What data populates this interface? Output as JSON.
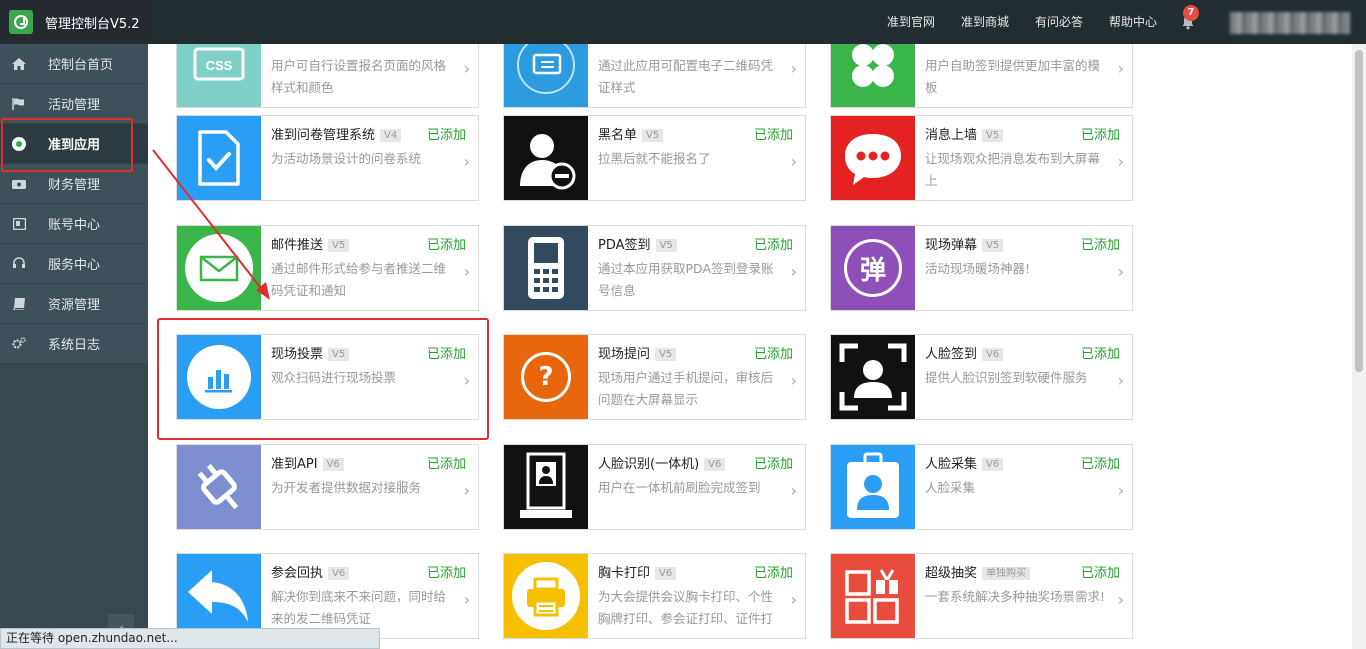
{
  "header": {
    "brand_title": "管理控制台V5.2",
    "nav": [
      "准到官网",
      "准到商城",
      "有问必答",
      "帮助中心"
    ],
    "notification_count": "7"
  },
  "sidebar": {
    "items": [
      {
        "label": "控制台首页",
        "icon": "home-icon"
      },
      {
        "label": "活动管理",
        "icon": "flag-icon"
      },
      {
        "label": "准到应用",
        "icon": "app-icon"
      },
      {
        "label": "财务管理",
        "icon": "finance-icon"
      },
      {
        "label": "账号中心",
        "icon": "account-icon"
      },
      {
        "label": "服务中心",
        "icon": "headset-icon"
      },
      {
        "label": "资源管理",
        "icon": "book-icon"
      },
      {
        "label": "系统日志",
        "icon": "cogs-icon"
      }
    ],
    "active_index": 2,
    "collapse_glyph": "‹"
  },
  "apps": [
    {
      "title": "",
      "ver": "",
      "added": "",
      "desc": "用户可自行设置报名页面的风格样式和颜色",
      "icon": "css-icon",
      "color": "#7fd1c7"
    },
    {
      "title": "",
      "ver": "",
      "added": "",
      "desc": "通过此应用可配置电子二维码凭证样式",
      "icon": "ticket-icon",
      "color": "#2d9be0"
    },
    {
      "title": "",
      "ver": "",
      "added": "",
      "desc": "用户自助签到提供更加丰富的模板",
      "icon": "clover-icon",
      "color": "#3ab54a"
    },
    {
      "title": "准到问卷管理系统",
      "ver": "V4",
      "added": "已添加",
      "desc": "为活动场景设计的问卷系统",
      "icon": "survey-icon",
      "color": "#2a9df4"
    },
    {
      "title": "黑名单",
      "ver": "V5",
      "added": "已添加",
      "desc": "拉黑后就不能报名了",
      "icon": "blacklist-icon",
      "color": "#111111"
    },
    {
      "title": "消息上墙",
      "ver": "V5",
      "added": "已添加",
      "desc": "让现场观众把消息发布到大屏幕上",
      "icon": "chat-icon",
      "color": "#e52222"
    },
    {
      "title": "邮件推送",
      "ver": "V5",
      "added": "已添加",
      "desc": "通过邮件形式给参与者推送二维码凭证和通知",
      "icon": "mail-icon",
      "color": "#39b54a"
    },
    {
      "title": "PDA签到",
      "ver": "V5",
      "added": "已添加",
      "desc": "通过本应用获取PDA签到登录账号信息",
      "icon": "pda-icon",
      "color": "#334a5e"
    },
    {
      "title": "现场弹幕",
      "ver": "V5",
      "added": "已添加",
      "desc": "活动现场暖场神器!",
      "icon": "danmu-icon",
      "color": "#8e4fb8",
      "glyph": "弹"
    },
    {
      "title": "现场投票",
      "ver": "V5",
      "added": "已添加",
      "desc": "观众扫码进行现场投票",
      "icon": "vote-icon",
      "color": "#2a9df4"
    },
    {
      "title": "现场提问",
      "ver": "V5",
      "added": "已添加",
      "desc": "现场用户通过手机提问，审核后问题在大屏幕显示",
      "icon": "question-icon",
      "color": "#e8660c",
      "glyph": "?"
    },
    {
      "title": "人脸签到",
      "ver": "V6",
      "added": "已添加",
      "desc": "提供人脸识别签到软硬件服务",
      "icon": "face-checkin-icon",
      "color": "#111111"
    },
    {
      "title": "准到API",
      "ver": "V6",
      "added": "已添加",
      "desc": "为开发者提供数据对接服务",
      "icon": "plug-icon",
      "color": "#7e8fcf"
    },
    {
      "title": "人脸识别(一体机)",
      "ver": "V6",
      "added": "已添加",
      "desc": "用户在一体机前刷脸完成签到",
      "icon": "kiosk-icon",
      "color": "#111111"
    },
    {
      "title": "人脸采集",
      "ver": "V6",
      "added": "已添加",
      "desc": "人脸采集",
      "icon": "badge-icon",
      "color": "#2a9df4"
    },
    {
      "title": "参会回执",
      "ver": "V6",
      "added": "已添加",
      "desc": "解决你到底来不来问题，同时给来的发二维码凭证",
      "icon": "reply-icon",
      "color": "#2a9df4"
    },
    {
      "title": "胸卡打印",
      "ver": "V6",
      "added": "已添加",
      "desc": "为大会提供会议胸卡打印、个性胸牌打印、参会证打印、证件打",
      "icon": "printer-icon",
      "color": "#f6c000"
    },
    {
      "title": "超级抽奖",
      "ver": "单独购买",
      "added": "已添加",
      "desc": "一套系统解决多种抽奖场景需求!",
      "icon": "lottery-icon",
      "color": "#e84c3d"
    }
  ],
  "statusbar": {
    "text": "正在等待 open.zhundao.net..."
  }
}
